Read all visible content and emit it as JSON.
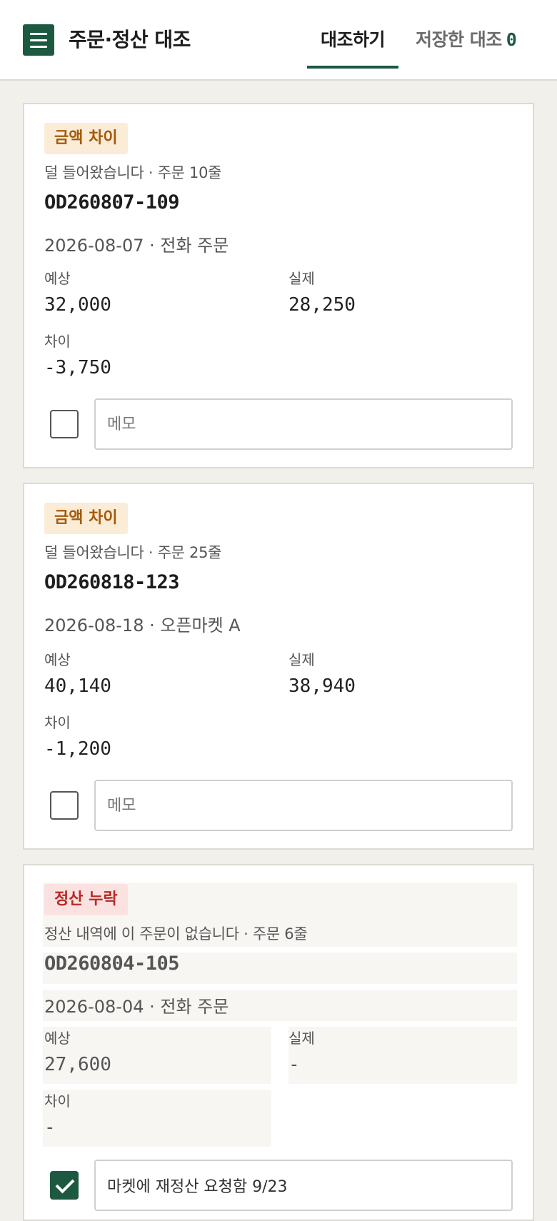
{
  "header": {
    "menu_icon": "hamburger-menu-icon",
    "title": "주문·정산 대조",
    "tabs": [
      {
        "label": "대조하기",
        "active": true
      },
      {
        "label": "저장한 대조",
        "count": "0",
        "active": false
      }
    ]
  },
  "colors": {
    "accent": "#1d5940",
    "amount_badge_bg": "#fbecd7",
    "amount_badge_text": "#a35a0b",
    "missing_badge_bg": "#fbe1df",
    "missing_badge_text": "#b42a26",
    "background": "#f1f0ea"
  },
  "labels": {
    "expected": "예상",
    "actual": "실제",
    "difference": "차이"
  },
  "cards": [
    {
      "badge": "금액 차이",
      "description": "덜 들어왔습니다 · 주문 10줄",
      "order_id": "OD260807-109",
      "meta": "2026-08-07 · 전화 주문",
      "expected": "32,000",
      "actual": "28,250",
      "difference": "-3,750",
      "checked": false,
      "memo_placeholder": "메모",
      "memo_value": ""
    },
    {
      "badge": "금액 차이",
      "description": "덜 들어왔습니다 · 주문 25줄",
      "order_id": "OD260818-123",
      "meta": "2026-08-18 · 오픈마켓 A",
      "expected": "40,140",
      "actual": "38,940",
      "difference": "-1,200",
      "checked": false,
      "memo_placeholder": "메모",
      "memo_value": ""
    },
    {
      "badge": "정산 누락",
      "description": "정산 내역에 이 주문이 없습니다 · 주문 6줄",
      "order_id": "OD260804-105",
      "meta": "2026-08-04 · 전화 주문",
      "expected": "27,600",
      "actual": "-",
      "difference": "-",
      "checked": true,
      "memo_placeholder": "메모",
      "memo_value": "마켓에 재정산 요청함 9/23"
    }
  ]
}
